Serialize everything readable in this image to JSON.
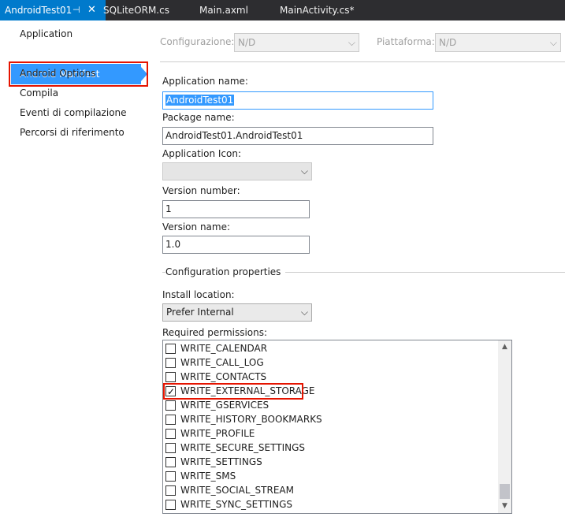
{
  "tabs": [
    {
      "label": "AndroidTest01",
      "active": true
    },
    {
      "label": "SQLiteORM.cs"
    },
    {
      "label": "Main.axml"
    },
    {
      "label": "MainActivity.cs*"
    }
  ],
  "tab_pin_glyph": "⊣",
  "tab_close_glyph": "✕",
  "nav": [
    "Application",
    "Android Manifest",
    "Android Options",
    "Compila",
    "Eventi di compilazione",
    "Percorsi di riferimento"
  ],
  "config": {
    "configurazione_label": "Configurazione:",
    "configurazione_value": "N/D",
    "piattaforma_label": "Piattaforma:",
    "piattaforma_value": "N/D"
  },
  "form": {
    "app_name_label": "Application name:",
    "app_name_value": "AndroidTest01",
    "package_name_label": "Package name:",
    "package_name_value": "AndroidTest01.AndroidTest01",
    "app_icon_label": "Application Icon:",
    "app_icon_value": "",
    "version_number_label": "Version number:",
    "version_number_value": "1",
    "version_name_label": "Version name:",
    "version_name_value": "1.0",
    "config_props_title": "Configuration properties",
    "install_location_label": "Install location:",
    "install_location_value": "Prefer Internal",
    "required_permissions_label": "Required permissions:"
  },
  "permissions": [
    {
      "name": "WRITE_CALENDAR",
      "checked": false
    },
    {
      "name": "WRITE_CALL_LOG",
      "checked": false
    },
    {
      "name": "WRITE_CONTACTS",
      "checked": false
    },
    {
      "name": "WRITE_EXTERNAL_STORAGE",
      "checked": true
    },
    {
      "name": "WRITE_GSERVICES",
      "checked": false
    },
    {
      "name": "WRITE_HISTORY_BOOKMARKS",
      "checked": false
    },
    {
      "name": "WRITE_PROFILE",
      "checked": false
    },
    {
      "name": "WRITE_SECURE_SETTINGS",
      "checked": false
    },
    {
      "name": "WRITE_SETTINGS",
      "checked": false
    },
    {
      "name": "WRITE_SMS",
      "checked": false
    },
    {
      "name": "WRITE_SOCIAL_STREAM",
      "checked": false
    },
    {
      "name": "WRITE_SYNC_SETTINGS",
      "checked": false
    }
  ],
  "colors": {
    "tab_bar_bg": "#2d2d30",
    "active_tab_bg": "#007acc",
    "nav_selected_bg": "#3399ff",
    "highlight_box": "#e51400"
  }
}
